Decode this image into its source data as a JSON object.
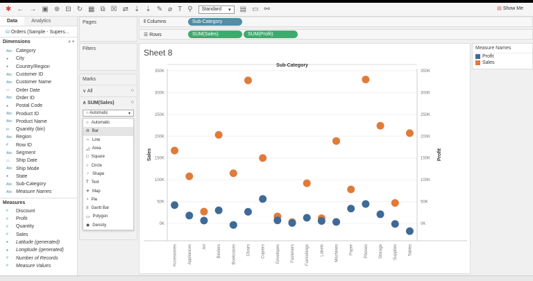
{
  "toolbar": {
    "standard": "Standard",
    "show_me": "Show Me"
  },
  "left": {
    "tabs": [
      "Data",
      "Analytics"
    ],
    "source": "Orders (Sample - Supers...",
    "dimensions_title": "Dimensions",
    "measures_title": "Measures",
    "dimensions": [
      {
        "icon": "Abc",
        "label": "Category"
      },
      {
        "icon": "globe",
        "label": "City"
      },
      {
        "icon": "globe",
        "label": "Country/Region"
      },
      {
        "icon": "Abc",
        "label": "Customer ID"
      },
      {
        "icon": "Abc",
        "label": "Customer Name"
      },
      {
        "icon": "calendar",
        "label": "Order Date"
      },
      {
        "icon": "Abc",
        "label": "Order ID"
      },
      {
        "icon": "globe",
        "label": "Postal Code"
      },
      {
        "icon": "Abc",
        "label": "Product ID"
      },
      {
        "icon": "Abc",
        "label": "Product Name"
      },
      {
        "icon": "bin",
        "label": "Quantity (bin)"
      },
      {
        "icon": "Abc",
        "label": "Region"
      },
      {
        "icon": "#",
        "label": "Row ID"
      },
      {
        "icon": "Abc",
        "label": "Segment"
      },
      {
        "icon": "calendar",
        "label": "Ship Date"
      },
      {
        "icon": "Abc",
        "label": "Ship Mode"
      },
      {
        "icon": "globe",
        "label": "State"
      },
      {
        "icon": "Abc",
        "label": "Sub-Category"
      },
      {
        "icon": "Abc",
        "label": "Measure Names",
        "italic": true
      }
    ],
    "measures": [
      {
        "icon": "#",
        "label": "Discount"
      },
      {
        "icon": "#",
        "label": "Profit"
      },
      {
        "icon": "#",
        "label": "Quantity"
      },
      {
        "icon": "#",
        "label": "Sales"
      },
      {
        "icon": "globe",
        "label": "Latitude (generated)",
        "italic": true
      },
      {
        "icon": "globe",
        "label": "Longitude (generated)",
        "italic": true
      },
      {
        "icon": "#",
        "label": "Number of Records",
        "italic": true
      },
      {
        "icon": "#",
        "label": "Measure Values",
        "italic": true
      }
    ]
  },
  "shelves": {
    "pages": "Pages",
    "filters": "Filters",
    "marks": "Marks",
    "all": "All",
    "sum_sales": "SUM(Sales)",
    "mark_type": "Automatic",
    "mark_options": [
      "Automatic",
      "Bar",
      "Line",
      "Area",
      "Square",
      "Circle",
      "Shape",
      "Text",
      "Map",
      "Pie",
      "Gantt Bar",
      "Polygon",
      "Density"
    ],
    "highlighted": "Bar"
  },
  "columns": {
    "label": "Columns",
    "pills": [
      "Sub-Category"
    ]
  },
  "rows": {
    "label": "Rows",
    "pills": [
      "SUM(Sales)",
      "SUM(Profit)"
    ]
  },
  "sheet": {
    "title": "Sheet 8"
  },
  "legend": {
    "title": "Measure Names",
    "items": [
      {
        "label": "Profit",
        "color": "#3f6a97"
      },
      {
        "label": "Sales",
        "color": "#e07b39"
      }
    ]
  },
  "chart_data": {
    "type": "scatter",
    "title": "Sub-Category",
    "ylabel_left": "Sales",
    "ylabel_right": "Profit",
    "ylim": [
      -25000,
      350000
    ],
    "yticks": [
      "0K",
      "50K",
      "100K",
      "150K",
      "200K",
      "250K",
      "300K",
      "350K"
    ],
    "categories": [
      "Accessories",
      "Appliances",
      "Art",
      "Binders",
      "Bookcases",
      "Chairs",
      "Copiers",
      "Envelopes",
      "Fasteners",
      "Furnishings",
      "Labels",
      "Machines",
      "Paper",
      "Phones",
      "Storage",
      "Supplies",
      "Tables"
    ],
    "series": [
      {
        "name": "Sales",
        "color": "#e07b39",
        "values": [
          167000,
          108000,
          27000,
          203000,
          115000,
          328000,
          150000,
          16000,
          3000,
          92000,
          12000,
          189000,
          78000,
          330000,
          224000,
          47000,
          207000
        ]
      },
      {
        "name": "Profit",
        "color": "#3f6a97",
        "values": [
          42000,
          18000,
          6500,
          30000,
          -3500,
          26600,
          56000,
          7000,
          1000,
          13000,
          5500,
          3400,
          34000,
          44500,
          21000,
          -1200,
          -17700
        ]
      }
    ]
  }
}
